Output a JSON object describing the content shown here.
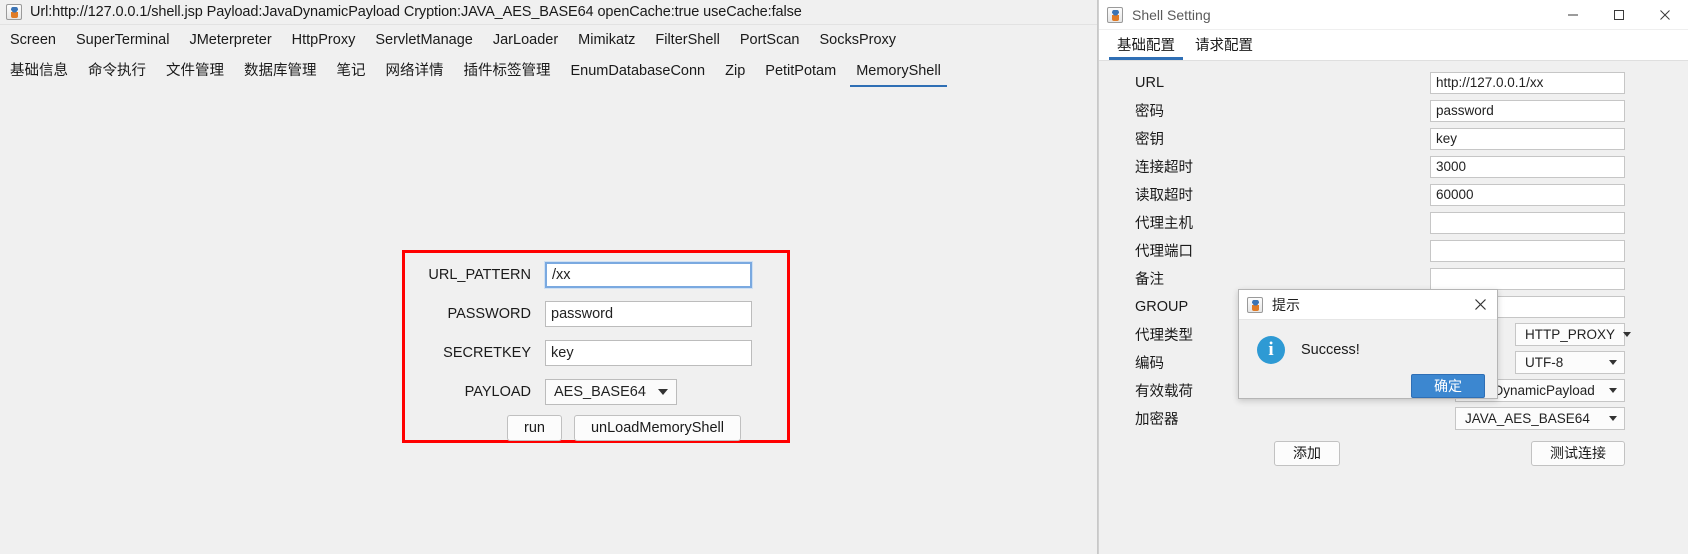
{
  "main_window": {
    "title": "Url:http://127.0.0.1/shell.jsp Payload:JavaDynamicPayload Cryption:JAVA_AES_BASE64 openCache:true useCache:false",
    "icon": "java-app-icon",
    "menu_row_1": [
      {
        "label": "Screen"
      },
      {
        "label": "SuperTerminal"
      },
      {
        "label": "JMeterpreter"
      },
      {
        "label": "HttpProxy"
      },
      {
        "label": "ServletManage"
      },
      {
        "label": "JarLoader"
      },
      {
        "label": "Mimikatz"
      },
      {
        "label": "FilterShell"
      },
      {
        "label": "PortScan"
      },
      {
        "label": "SocksProxy"
      }
    ],
    "menu_row_2": [
      {
        "label": "基础信息",
        "selected": false
      },
      {
        "label": "命令执行",
        "selected": false
      },
      {
        "label": "文件管理",
        "selected": false
      },
      {
        "label": "数据库管理",
        "selected": false
      },
      {
        "label": "笔记",
        "selected": false
      },
      {
        "label": "网络详情",
        "selected": false
      },
      {
        "label": "插件标签管理",
        "selected": false
      },
      {
        "label": "EnumDatabaseConn",
        "selected": false
      },
      {
        "label": "Zip",
        "selected": false
      },
      {
        "label": "PetitPotam",
        "selected": false
      },
      {
        "label": "MemoryShell",
        "selected": true
      }
    ]
  },
  "memory_shell_form": {
    "highlight_color": "#ff0000",
    "fields": [
      {
        "label": "URL_PATTERN",
        "value": "/xx",
        "focused": true
      },
      {
        "label": "PASSWORD",
        "value": "password",
        "focused": false
      },
      {
        "label": "SECRETKEY",
        "value": "key",
        "focused": false
      }
    ],
    "payload": {
      "label": "PAYLOAD",
      "value": "AES_BASE64"
    },
    "buttons": [
      {
        "label": "run"
      },
      {
        "label": "unLoadMemoryShell"
      }
    ]
  },
  "shell_setting": {
    "title": "Shell Setting",
    "icon": "java-app-icon",
    "window_controls": {
      "minimize": "minimize-icon",
      "maximize": "maximize-icon",
      "close": "close-icon"
    },
    "tabs": [
      {
        "label": "基础配置",
        "selected": true
      },
      {
        "label": "请求配置",
        "selected": false
      }
    ],
    "text_fields": [
      {
        "label": "URL",
        "value": "http://127.0.0.1/xx"
      },
      {
        "label": "密码",
        "value": "password"
      },
      {
        "label": "密钥",
        "value": "key"
      },
      {
        "label": "连接超时",
        "value": "3000"
      },
      {
        "label": "读取超时",
        "value": "60000"
      },
      {
        "label": "代理主机",
        "value": ""
      },
      {
        "label": "代理端口",
        "value": ""
      },
      {
        "label": "备注",
        "value": ""
      },
      {
        "label": "GROUP",
        "value": ""
      }
    ],
    "combo_fields": [
      {
        "label": "代理类型",
        "value": "HTTP_PROXY",
        "wide": false
      },
      {
        "label": "编码",
        "value": "UTF-8",
        "wide": false
      },
      {
        "label": "有效载荷",
        "value": "JavaDynamicPayload",
        "wide": true
      },
      {
        "label": "加密器",
        "value": "JAVA_AES_BASE64",
        "wide": true
      }
    ],
    "buttons": [
      {
        "label": "添加"
      },
      {
        "label": "测试连接"
      }
    ]
  },
  "dialog": {
    "title": "提示",
    "icon": "java-app-icon",
    "close_icon": "close-icon",
    "info_icon": "info-icon",
    "message": "Success!",
    "ok_label": "确定",
    "ok_color": "#3c87d0"
  }
}
